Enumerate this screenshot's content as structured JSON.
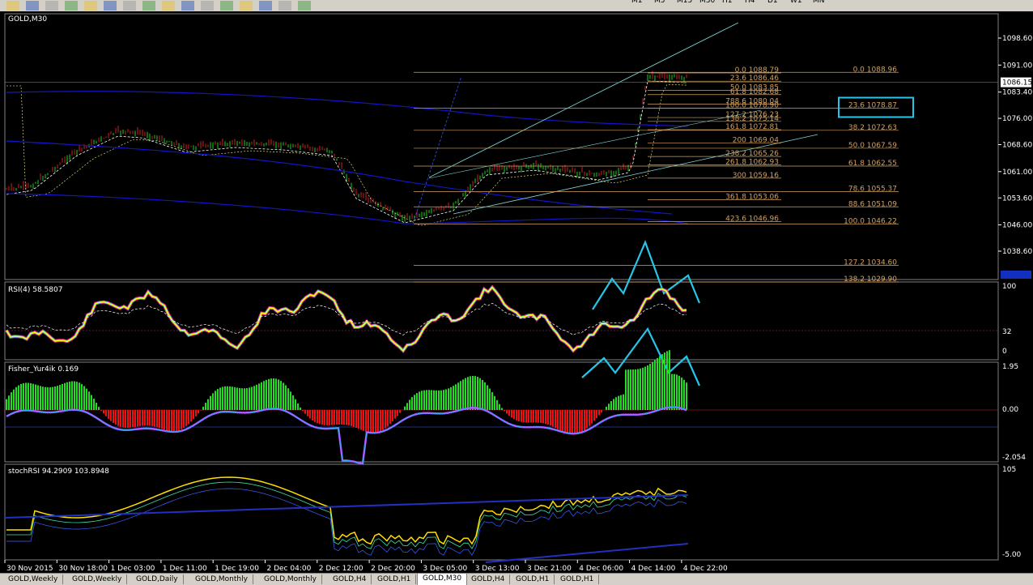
{
  "toolbar": {
    "icons": [
      "new-chart-icon",
      "save-icon",
      "print-icon",
      "crosshair-icon",
      "zoom-in-icon",
      "zoom-out-icon",
      "add-indicator-icon",
      "autoscroll-icon",
      "templates-icon",
      "cursor-icon",
      "line-icon",
      "hline-icon",
      "channel-icon",
      "fibo-icon",
      "text-icon",
      "arrows-icon"
    ],
    "timeframes": [
      "M1",
      "M5",
      "M15",
      "M30",
      "H1",
      "H4",
      "D1",
      "W1",
      "MN"
    ]
  },
  "chart": {
    "symbol": "GOLD,M30",
    "price_ticks": [
      "1098.60",
      "1091.00",
      "1083.40",
      "1076.00",
      "1068.60",
      "1061.00",
      "1053.60",
      "1046.00",
      "1038.60"
    ],
    "current_price": "1086.15",
    "time_labels": [
      "30 Nov 2015",
      "30 Nov 18:00",
      "1 Dec 03:00",
      "1 Dec 11:00",
      "1 Dec 19:00",
      "2 Dec 04:00",
      "2 Dec 12:00",
      "2 Dec 20:00",
      "3 Dec 05:00",
      "3 Dec 13:00",
      "3 Dec 21:00",
      "4 Dec 06:00",
      "4 Dec 14:00",
      "4 Dec 22:00"
    ],
    "fib_left": [
      {
        "label": "0.0  1088.79"
      },
      {
        "label": "23.6  1086.46"
      },
      {
        "label": "50.0  1083.85"
      },
      {
        "label": "61.8  1082.68"
      },
      {
        "label": "788.6  1080.04"
      },
      {
        "label": "100.0  1078.90"
      },
      {
        "label": "127.2  1076.23"
      },
      {
        "label": "138.2  1075.14"
      },
      {
        "label": "161.8  1072.81"
      },
      {
        "label": "200  1069.04"
      },
      {
        "label": "238.2  1065.26"
      },
      {
        "label": "261.8  1062.93"
      },
      {
        "label": "300  1059.16"
      },
      {
        "label": "361.8  1053.06"
      },
      {
        "label": "423.6  1046.96"
      }
    ],
    "fib_right": [
      {
        "label": "0.0  1088.96"
      },
      {
        "label": "23.6  1078.87"
      },
      {
        "label": "38.2  1072.63"
      },
      {
        "label": "50.0  1067.59"
      },
      {
        "label": "61.8  1062.55"
      },
      {
        "label": "78.6  1055.37"
      },
      {
        "label": "88.6  1051.09"
      },
      {
        "label": "100.0  1046.22"
      },
      {
        "label": "127.2  1034.60"
      },
      {
        "label": "138.2  1029.90"
      }
    ]
  },
  "rsi": {
    "title": "RSI(4) 58.5807",
    "ticks": [
      "100",
      "32",
      "0"
    ]
  },
  "fisher": {
    "title": "Fisher_Yur4ik 0.169",
    "ticks": [
      "1.95",
      "0.00",
      "-2.054"
    ]
  },
  "stoch": {
    "title": "stochRSI 94.2909 103.8948",
    "ticks": [
      "105",
      "-5.00"
    ]
  },
  "tabs": [
    "GOLD,Weekly",
    "GOLD,Weekly",
    "GOLD,Daily",
    "GOLD,Monthly",
    "GOLD,Monthly",
    "GOLD,H4",
    "GOLD,H1",
    "GOLD,M30",
    "GOLD,H4",
    "GOLD,H1",
    "GOLD,H1"
  ],
  "active_tab": 7,
  "colors": {
    "background": "#000000",
    "fib": "#d2a060",
    "channel": "#7fd8d8",
    "highlight": "#27c6e8",
    "rsi": "#ffff00",
    "hist_pos": "#22dd22",
    "hist_neg": "#ee1111",
    "ma": "#1414c8"
  }
}
